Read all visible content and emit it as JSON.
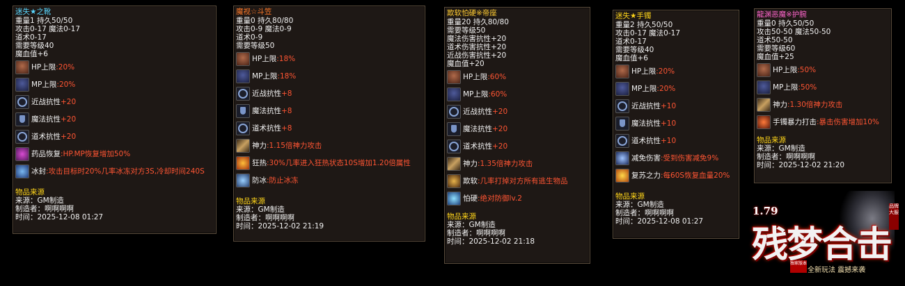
{
  "cards": [
    {
      "title": "迷失★之靴",
      "title_color": "#5ad7ff",
      "stats": [
        "重量1 持久50/50",
        "攻击0-17 魔法0-17",
        "道术0-17",
        "需要等级40",
        "魔血值+6"
      ],
      "props": [
        {
          "icon": "hp-icon",
          "label": "HP上限",
          "value": ":20%"
        },
        {
          "icon": "mp-icon",
          "label": "MP上限",
          "value": ":20%"
        },
        {
          "icon": "melee-resist-icon",
          "label": "近战抗性",
          "value": "+20"
        },
        {
          "icon": "magic-resist-icon",
          "label": "魔法抗性",
          "value": "+20"
        },
        {
          "icon": "taoist-resist-icon",
          "label": "道术抗性",
          "value": "+20"
        },
        {
          "icon": "potion-icon",
          "label": "药品恢复",
          "value": ":HP.MP恢复增加50%"
        },
        {
          "icon": "freeze-icon",
          "label": "冰封",
          "value": ":攻击目标时20%几率冰冻对方3S,冷却时间240S"
        }
      ],
      "source_title": "物品来源",
      "source_lines": [
        "来源：GM制造",
        "制造者：啊啊啊啊",
        "时间：2025-12-08 01:27"
      ]
    },
    {
      "title": "魔视☆斗笠",
      "title_color": "#ff7a2a",
      "stats": [
        "重量0 持久80/80",
        "攻击0-9 魔法0-9",
        "道术0-9",
        "需要等级50"
      ],
      "props": [
        {
          "icon": "hp-icon",
          "label": "HP上限",
          "value": ":18%"
        },
        {
          "icon": "mp-icon",
          "label": "MP上限",
          "value": ":18%"
        },
        {
          "icon": "melee-resist-icon",
          "label": "近战抗性",
          "value": "+8"
        },
        {
          "icon": "magic-resist-icon",
          "label": "魔法抗性",
          "value": "+8"
        },
        {
          "icon": "taoist-resist-icon",
          "label": "道术抗性",
          "value": "+8"
        },
        {
          "icon": "divine-power-icon",
          "label": "神力",
          "value": ":1.15倍神力攻击"
        },
        {
          "icon": "frenzy-icon",
          "label": "狂热",
          "value": ":30%几率进入狂热状态10S增加1.20倍属性"
        },
        {
          "icon": "anti-freeze-icon",
          "label": "防冰",
          "value": ":防止冰冻"
        }
      ],
      "source_title": "物品来源",
      "source_lines": [
        "来源：GM制造",
        "制造者：啊啊啊啊",
        "时间：2025-12-02 21:19"
      ]
    },
    {
      "title": "欺软怕硬※帝座",
      "title_color": "#ffcc33",
      "stats": [
        "重量20 持久80/80",
        "需要等级50",
        "魔法伤害抗性+20",
        "道术伤害抗性+20",
        "近战伤害抗性+20",
        "魔血值+20"
      ],
      "props": [
        {
          "icon": "hp-icon",
          "label": "HP上限",
          "value": ":60%"
        },
        {
          "icon": "mp-icon",
          "label": "MP上限",
          "value": ":60%"
        },
        {
          "icon": "melee-resist-icon",
          "label": "近战抗性",
          "value": "+20"
        },
        {
          "icon": "magic-resist-icon",
          "label": "魔法抗性",
          "value": "+20"
        },
        {
          "icon": "taoist-resist-icon",
          "label": "道术抗性",
          "value": "+20"
        },
        {
          "icon": "divine-power-icon",
          "label": "神力",
          "value": ":1.35倍神力攻击"
        },
        {
          "icon": "bully-icon",
          "label": "欺软",
          "value": ":几率打掉对方所有逃生物品"
        },
        {
          "icon": "defense-icon",
          "label": "怕硬",
          "value": ":绝对防御lv.2"
        }
      ],
      "source_title": "物品来源",
      "source_lines": [
        "来源：GM制造",
        "制造者：啊啊啊啊",
        "时间：2025-12-02 21:18"
      ]
    },
    {
      "title": "迷失★手镯",
      "title_color": "#ffd51a",
      "stats": [
        "重量2 持久50/50",
        "攻击0-17 魔法0-17",
        "道术0-17",
        "需要等级40",
        "魔血值+6"
      ],
      "props": [
        {
          "icon": "hp-icon",
          "label": "HP上限",
          "value": ":20%"
        },
        {
          "icon": "mp-icon",
          "label": "MP上限",
          "value": ":20%"
        },
        {
          "icon": "melee-resist-icon",
          "label": "近战抗性",
          "value": "+10"
        },
        {
          "icon": "magic-resist-icon",
          "label": "魔法抗性",
          "value": "+10"
        },
        {
          "icon": "taoist-resist-icon",
          "label": "道术抗性",
          "value": "+10"
        },
        {
          "icon": "damage-reduce-icon",
          "label": "减免伤害",
          "value": ":受到伤害减免9%"
        },
        {
          "icon": "revive-icon",
          "label": "复苏之力",
          "value": ":每60S恢复血量20%"
        }
      ],
      "source_title": "物品来源",
      "source_lines": [
        "来源：GM制造",
        "制造者：啊啊啊啊",
        "时间：2025-12-08 01:27"
      ]
    },
    {
      "title": "龍渊恶魔※护腕",
      "title_color": "#ff66cc",
      "stats": [
        "重量0 持久50/50",
        "攻击50-50 魔法50-50",
        "道术50-50",
        "需要等级60",
        "魔血值+25"
      ],
      "props": [
        {
          "icon": "hp-icon",
          "label": "HP上限",
          "value": ":50%"
        },
        {
          "icon": "mp-icon",
          "label": "MP上限",
          "value": ":50%"
        },
        {
          "icon": "divine-power-icon",
          "label": "神力",
          "value": ":1.30倍神力攻击"
        },
        {
          "icon": "bracelet-violence-icon",
          "label": "手镯暴力打击",
          "value": ":暴击伤害增加10%"
        }
      ],
      "source_title": "物品来源",
      "source_lines": [
        "来源：GM制造",
        "制造者：啊啊啊啊",
        "时间：2025-12-02 21:20"
      ]
    }
  ],
  "logo": {
    "version": "1.79",
    "brand": "残梦合击",
    "slogan": "全新玩法 震撼来袭",
    "tag": "独家版本",
    "seal": "品牌大服"
  }
}
